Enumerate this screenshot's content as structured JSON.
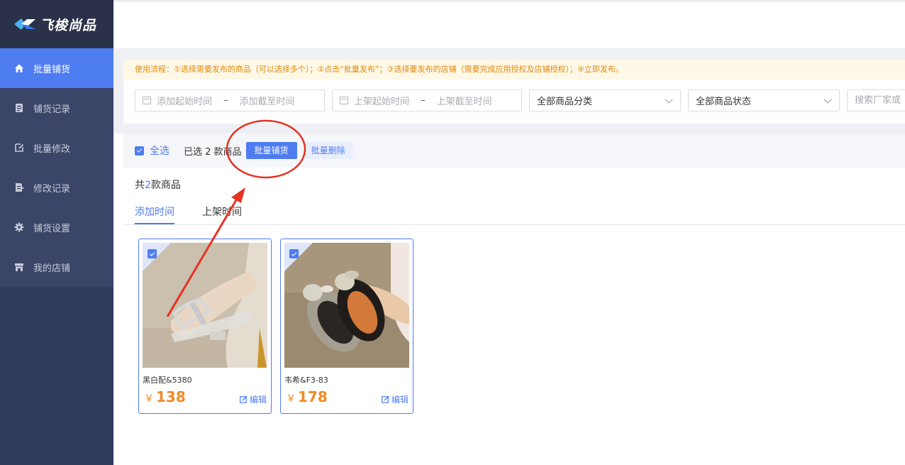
{
  "brand": {
    "name": "飞梭尚品"
  },
  "sidebar": {
    "items": [
      {
        "label": "批量铺货",
        "icon": "home-icon",
        "active": true
      },
      {
        "label": "铺货记录",
        "icon": "document-icon",
        "active": false
      },
      {
        "label": "批量修改",
        "icon": "edit-icon",
        "active": false
      },
      {
        "label": "修改记录",
        "icon": "record-icon",
        "active": false
      },
      {
        "label": "铺货设置",
        "icon": "gear-icon",
        "active": false
      },
      {
        "label": "我的店铺",
        "icon": "store-icon",
        "active": false
      }
    ]
  },
  "notice": "使用流程：①选择需要发布的商品（可以选择多个）；②点击“批量发布”；③选择要发布的店铺（需要完成应用授权及店铺授权）；④立即发布。",
  "filters": {
    "add_start": "添加起始时间",
    "add_end": "添加截至时间",
    "shelf_start": "上架起始时间",
    "shelf_end": "上架截至时间",
    "separator": "–",
    "category": "全部商品分类",
    "status": "全部商品状态",
    "search_placeholder": "搜索厂家或"
  },
  "actions": {
    "select_all": "全选",
    "selected_prefix": "已选 2 款商品",
    "bulk_distribute": "批量铺货",
    "bulk_delete": "批量删除"
  },
  "summary": {
    "prefix": "共",
    "count": "2",
    "suffix": "款商品"
  },
  "tabs": [
    {
      "label": "添加时间",
      "active": true
    },
    {
      "label": "上架时间",
      "active": false
    }
  ],
  "products": [
    {
      "name": "黑白配&5380",
      "price": "138",
      "currency": "￥",
      "edit": "编辑",
      "checked": true
    },
    {
      "name": "韦希&F3-83",
      "price": "178",
      "currency": "￥",
      "edit": "编辑",
      "checked": true
    }
  ],
  "colors": {
    "accent": "#4e7cf1",
    "sidebar": "#323c5d",
    "price": "#f08a24",
    "annotation": "#e53323"
  }
}
